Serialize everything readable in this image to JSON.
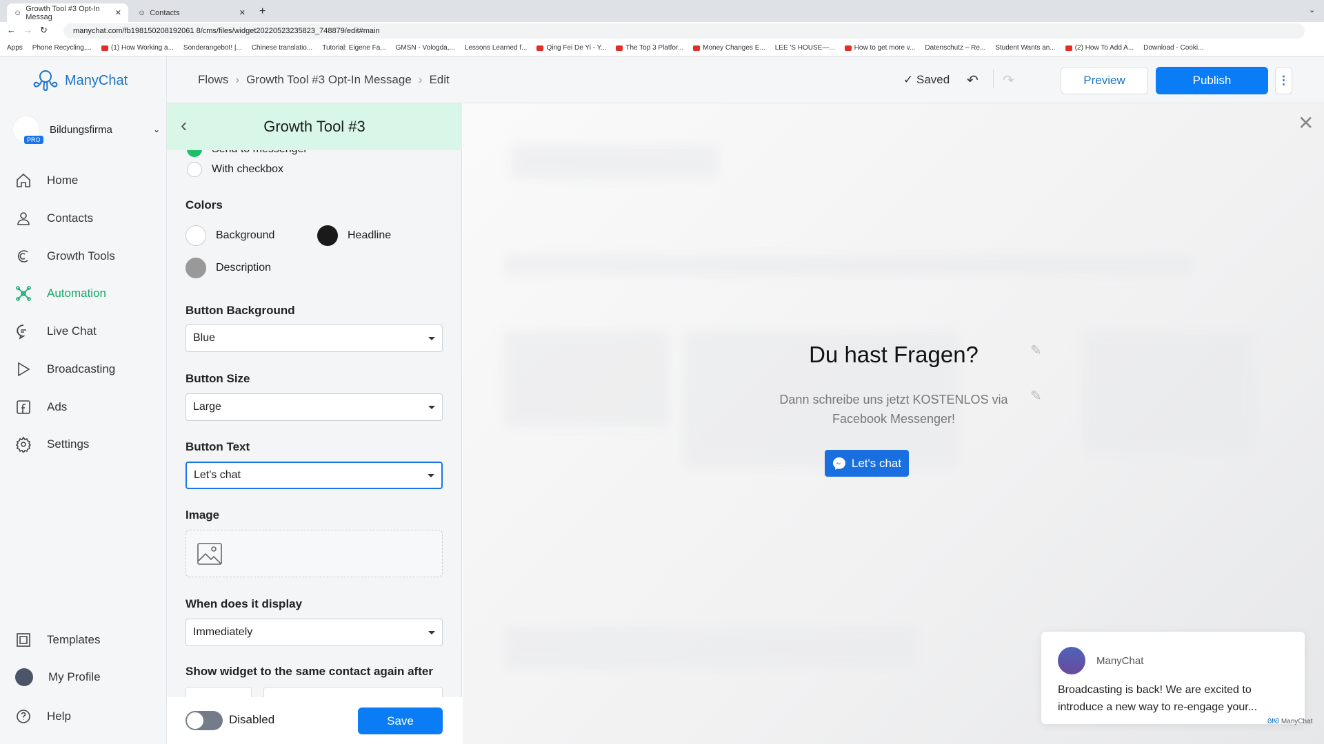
{
  "browser": {
    "tabs": [
      {
        "label": "Growth Tool #3 Opt-In Messag"
      },
      {
        "label": "Contacts"
      }
    ],
    "url": "manychat.com/fb198150208192061 8/cms/files/widget20220523235823_748879/edit#main",
    "bookmarks": [
      "Apps",
      "Phone Recycling,...",
      "(1) How Working a...",
      "Sonderangebot! |...",
      "Chinese translatio...",
      "Tutorial: Eigene Fa...",
      "GMSN - Vologda,...",
      "Lessons Learned f...",
      "Qing Fei De Yi - Y...",
      "The Top 3 Platfor...",
      "Money Changes E...",
      "LEE 'S HOUSE—...",
      "How to get more v...",
      "Datenschutz – Re...",
      "Student Wants an...",
      "(2) How To Add A...",
      "Download - Cooki..."
    ]
  },
  "sidebar": {
    "brand": "ManyChat",
    "account": {
      "name": "Bildungsfirma",
      "badge": "PRO"
    },
    "items": [
      {
        "label": "Home",
        "icon": "home-icon"
      },
      {
        "label": "Contacts",
        "icon": "person-icon"
      },
      {
        "label": "Growth Tools",
        "icon": "growth-icon"
      },
      {
        "label": "Automation",
        "icon": "automation-icon",
        "active": true
      },
      {
        "label": "Live Chat",
        "icon": "chat-icon"
      },
      {
        "label": "Broadcasting",
        "icon": "send-icon"
      },
      {
        "label": "Ads",
        "icon": "facebook-icon"
      },
      {
        "label": "Settings",
        "icon": "gear-icon"
      }
    ],
    "bottom": [
      {
        "label": "Templates"
      },
      {
        "label": "My Profile"
      },
      {
        "label": "Help"
      }
    ]
  },
  "header": {
    "breadcrumb": [
      "Flows",
      "Growth Tool #3 Opt-In Message",
      "Edit"
    ],
    "saved": "Saved",
    "preview": "Preview",
    "publish": "Publish"
  },
  "panel": {
    "title": "Growth Tool #3",
    "radio_cut": "Send to messenger",
    "radio_checkbox": "With checkbox",
    "colors_label": "Colors",
    "colors": [
      {
        "label": "Background",
        "value": "#ffffff"
      },
      {
        "label": "Headline",
        "value": "#1a1a1a"
      },
      {
        "label": "Description",
        "value": "#999999"
      }
    ],
    "button_background": {
      "label": "Button Background",
      "value": "Blue"
    },
    "button_size": {
      "label": "Button Size",
      "value": "Large"
    },
    "button_text": {
      "label": "Button Text",
      "value": "Let's chat"
    },
    "image_label": "Image",
    "display": {
      "label": "When does it display",
      "value": "Immediately"
    },
    "show_again_label": "Show widget to the same contact again after",
    "toggle_label": "Disabled",
    "toggle_on": false,
    "save": "Save"
  },
  "preview": {
    "headline": "Du hast Fragen?",
    "description": "Dann schreibe uns jetzt KOSTENLOS via Facebook Messenger!",
    "button": "Let's chat",
    "accent": "#1a6fe0"
  },
  "popup": {
    "sender": "ManyChat",
    "message": "Broadcasting is back! We are excited to introduce a new way to re-engage your...",
    "powered": "ManyChat"
  }
}
